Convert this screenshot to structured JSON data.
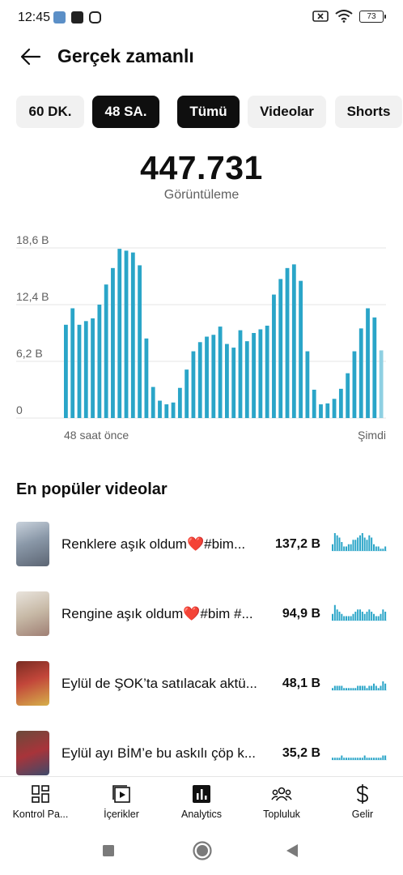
{
  "status_bar": {
    "time": "12:45",
    "battery": "73"
  },
  "header": {
    "title": "Gerçek zamanlı",
    "back_icon": "arrow-left-icon"
  },
  "chips": [
    {
      "label": "60 DK.",
      "active": false
    },
    {
      "label": "48 SA.",
      "active": true
    },
    {
      "label": "Tümü",
      "active": true
    },
    {
      "label": "Videolar",
      "active": false
    },
    {
      "label": "Shorts",
      "active": false
    }
  ],
  "summary": {
    "total": "447.731",
    "label": "Görüntüleme"
  },
  "chart_data": {
    "type": "bar",
    "y_ticks": [
      "18,6 B",
      "12,4 B",
      "6,2 B",
      "0"
    ],
    "ylim": [
      0,
      18600
    ],
    "x_start_label": "48 saat önce",
    "x_end_label": "Şimdi",
    "bar_color": "#2aa5c8",
    "last_bar_color": "#8fd0e2",
    "values": [
      10200,
      12000,
      10200,
      10600,
      10900,
      12400,
      14600,
      16400,
      18500,
      18300,
      18100,
      16700,
      8700,
      3400,
      1900,
      1500,
      1700,
      3300,
      5300,
      7300,
      8300,
      8900,
      9100,
      10000,
      8100,
      7700,
      9600,
      8400,
      9300,
      9700,
      10100,
      13500,
      15200,
      16400,
      16800,
      15000,
      7300,
      3100,
      1500,
      1600,
      2100,
      3200,
      4900,
      7300,
      9800,
      12000,
      11000,
      7400
    ]
  },
  "popular": {
    "title": "En popüler videolar",
    "videos": [
      {
        "title": "Renklere aşık oldum❤️#bim...",
        "views": "137,2 B",
        "spark": [
          3,
          8,
          7,
          6,
          4,
          2,
          2,
          3,
          3,
          5,
          5,
          6,
          7,
          8,
          6,
          5,
          7,
          6,
          3,
          2,
          2,
          1,
          1,
          2
        ]
      },
      {
        "title": "Rengine aşık oldum❤️#bim #...",
        "views": "94,9 B",
        "spark": [
          3,
          7,
          5,
          4,
          3,
          2,
          2,
          2,
          2,
          3,
          4,
          5,
          5,
          4,
          3,
          4,
          5,
          4,
          3,
          2,
          2,
          3,
          5,
          4
        ]
      },
      {
        "title": "Eylül de ŞOK’ta satılacak aktü...",
        "views": "48,1 B",
        "spark": [
          1,
          2,
          2,
          2,
          2,
          1,
          1,
          1,
          1,
          1,
          1,
          2,
          2,
          2,
          2,
          1,
          2,
          2,
          3,
          2,
          1,
          2,
          4,
          3
        ]
      },
      {
        "title": "Eylül ayı BİM’e bu askılı çöp k...",
        "views": "35,2 B",
        "spark": [
          1,
          1,
          1,
          1,
          2,
          1,
          1,
          1,
          1,
          1,
          1,
          1,
          1,
          1,
          2,
          1,
          1,
          1,
          1,
          1,
          1,
          1,
          2,
          2
        ]
      }
    ]
  },
  "bottom_nav": [
    {
      "label": "Kontrol Pa...",
      "icon": "dashboard-icon"
    },
    {
      "label": "İçerikler",
      "icon": "content-icon"
    },
    {
      "label": "Analytics",
      "icon": "analytics-icon"
    },
    {
      "label": "Topluluk",
      "icon": "community-icon"
    },
    {
      "label": "Gelir",
      "icon": "dollar-icon"
    }
  ]
}
